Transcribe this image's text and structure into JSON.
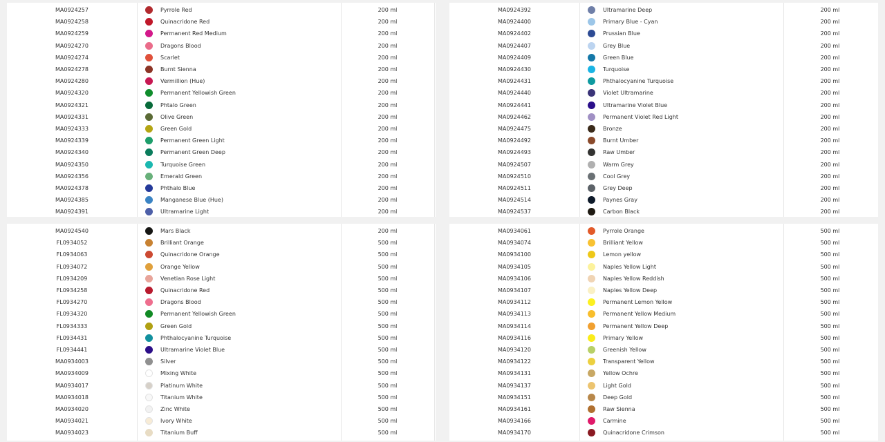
{
  "panels": [
    {
      "rows": [
        {
          "code": "MA0924257",
          "color": "#b22a2e",
          "name": "Pyrrole Red",
          "volume": "200 ml"
        },
        {
          "code": "MA0924258",
          "color": "#c0182a",
          "name": "Quinacridone Red",
          "volume": "200 ml"
        },
        {
          "code": "MA0924259",
          "color": "#d3198a",
          "name": "Permanent Red Medium",
          "volume": "200 ml"
        },
        {
          "code": "MA0924270",
          "color": "#ea6c8a",
          "name": "Dragons Blood",
          "volume": "200 ml"
        },
        {
          "code": "MA0924274",
          "color": "#e0513b",
          "name": "Scarlet",
          "volume": "200 ml"
        },
        {
          "code": "MA0924278",
          "color": "#8c3426",
          "name": "Burnt Sienna",
          "volume": "200 ml"
        },
        {
          "code": "MA0924280",
          "color": "#c71852",
          "name": "Vermillion (Hue)",
          "volume": "200 ml"
        },
        {
          "code": "MA0924320",
          "color": "#0f8c2c",
          "name": "Permanent Yellowish Green",
          "volume": "200 ml"
        },
        {
          "code": "MA0924321",
          "color": "#086a3a",
          "name": "Phtalo Green",
          "volume": "200 ml"
        },
        {
          "code": "MA0924331",
          "color": "#5b6a35",
          "name": "Olive Green",
          "volume": "200 ml"
        },
        {
          "code": "MA0924333",
          "color": "#b4a513",
          "name": "Green Gold",
          "volume": "200 ml"
        },
        {
          "code": "MA0924339",
          "color": "#1e9e6b",
          "name": "Permanent Green Light",
          "volume": "200 ml"
        },
        {
          "code": "MA0924340",
          "color": "#0a7c5c",
          "name": "Permanent Green Deep",
          "volume": "200 ml"
        },
        {
          "code": "MA0924350",
          "color": "#1bb8b0",
          "name": "Turquoise Green",
          "volume": "200 ml"
        },
        {
          "code": "MA0924356",
          "color": "#68b07a",
          "name": "Emerald Green",
          "volume": "200 ml"
        },
        {
          "code": "MA0924378",
          "color": "#253a9a",
          "name": "Phthalo Blue",
          "volume": "200 ml"
        },
        {
          "code": "MA0924385",
          "color": "#3b84c4",
          "name": "Manganese Blue (Hue)",
          "volume": "200 ml"
        },
        {
          "code": "MA0924391",
          "color": "#4d5fa8",
          "name": "Ultramarine Light",
          "volume": "200 ml"
        }
      ]
    },
    {
      "rows": [
        {
          "code": "MA0924392",
          "color": "#6f7fa8",
          "name": "Ultramarine Deep",
          "volume": "200 ml"
        },
        {
          "code": "MA0924400",
          "color": "#9cc6e8",
          "name": "Primary Blue - Cyan",
          "volume": "200 ml"
        },
        {
          "code": "MA0924402",
          "color": "#2d4b94",
          "name": "Prussian Blue",
          "volume": "200 ml"
        },
        {
          "code": "MA0924407",
          "color": "#bcd4f0",
          "name": "Grey Blue",
          "volume": "200 ml"
        },
        {
          "code": "MA0924409",
          "color": "#1478a8",
          "name": "Green Blue",
          "volume": "200 ml"
        },
        {
          "code": "MA0924430",
          "color": "#1ab4e4",
          "name": "Turquoise",
          "volume": "200 ml"
        },
        {
          "code": "MA0924431",
          "color": "#0e9aa0",
          "name": "Phthalocyanine Turquoise",
          "volume": "200 ml"
        },
        {
          "code": "MA0924440",
          "color": "#3a3478",
          "name": "Violet Ultramarine",
          "volume": "200 ml"
        },
        {
          "code": "MA0924441",
          "color": "#2a0e8a",
          "name": "Ultramarine Violet Blue",
          "volume": "200 ml"
        },
        {
          "code": "MA0924462",
          "color": "#a090c4",
          "name": "Permanent Violet Red Light",
          "volume": "200 ml"
        },
        {
          "code": "MA0924475",
          "color": "#3a2a1a",
          "name": "Bronze",
          "volume": "200 ml"
        },
        {
          "code": "MA0924492",
          "color": "#8a4a2c",
          "name": "Burnt Umber",
          "volume": "200 ml"
        },
        {
          "code": "MA0924493",
          "color": "#333331",
          "name": "Raw Umber",
          "volume": "200 ml"
        },
        {
          "code": "MA0924507",
          "color": "#b0b0b0",
          "name": "Warm Grey",
          "volume": "200 ml"
        },
        {
          "code": "MA0924510",
          "color": "#6a7074",
          "name": "Cool Grey",
          "volume": "200 ml"
        },
        {
          "code": "MA0924511",
          "color": "#5c6268",
          "name": "Grey Deep",
          "volume": "200 ml"
        },
        {
          "code": "MA0924514",
          "color": "#0e1a2a",
          "name": "Paynes Gray",
          "volume": "200 ml"
        },
        {
          "code": "MA0924537",
          "color": "#1e1a12",
          "name": "Carbon Black",
          "volume": "200 ml"
        }
      ]
    },
    {
      "rows": [
        {
          "code": "MA0924540",
          "color": "#161614",
          "name": "Mars Black",
          "volume": "200 ml"
        },
        {
          "code": "FL0934052",
          "color": "#c88232",
          "name": "Brilliant Orange",
          "volume": "500 ml"
        },
        {
          "code": "FL0934063",
          "color": "#cc4a32",
          "name": "Quinacridone Orange",
          "volume": "500 ml"
        },
        {
          "code": "FL0934072",
          "color": "#e0a03c",
          "name": "Orange Yellow",
          "volume": "500 ml"
        },
        {
          "code": "FL0934209",
          "color": "#e8a49a",
          "name": "Venetian Rose Light",
          "volume": "500 ml"
        },
        {
          "code": "FL0934258",
          "color": "#b81a2e",
          "name": "Quinacridone Red",
          "volume": "500 ml"
        },
        {
          "code": "FL0934270",
          "color": "#ee6e8e",
          "name": "Dragons Blood",
          "volume": "500 ml"
        },
        {
          "code": "FL0934320",
          "color": "#118a24",
          "name": "Permanent Yellowish Green",
          "volume": "500 ml"
        },
        {
          "code": "FL0934333",
          "color": "#b0a012",
          "name": "Green Gold",
          "volume": "500 ml"
        },
        {
          "code": "FL0934431",
          "color": "#12909e",
          "name": "Phthalocyanine Turquoise",
          "volume": "500 ml"
        },
        {
          "code": "FL0934441",
          "color": "#2c0e88",
          "name": "Ultramarine Violet Blue",
          "volume": "500 ml"
        },
        {
          "code": "MA0934003",
          "color": "#909090",
          "name": "Silver",
          "volume": "500 ml"
        },
        {
          "code": "MA0934009",
          "color": "#ffffff",
          "name": "Mixing White",
          "volume": "500 ml",
          "light": true
        },
        {
          "code": "MA0934017",
          "color": "#d6d0c8",
          "name": "Platinum White",
          "volume": "500 ml",
          "light": true
        },
        {
          "code": "MA0934018",
          "color": "#f8f8f8",
          "name": "Titanium White",
          "volume": "500 ml",
          "light": true
        },
        {
          "code": "MA0934020",
          "color": "#f2f2f2",
          "name": "Zinc White",
          "volume": "500 ml",
          "light": true
        },
        {
          "code": "MA0934021",
          "color": "#f8ecd6",
          "name": "Ivory White",
          "volume": "500 ml",
          "light": true
        },
        {
          "code": "MA0934023",
          "color": "#e8dcc4",
          "name": "Titanium Buff",
          "volume": "500 ml"
        }
      ]
    },
    {
      "rows": [
        {
          "code": "MA0934061",
          "color": "#e25a2a",
          "name": "Pyrrole Orange",
          "volume": "500 ml"
        },
        {
          "code": "MA0934074",
          "color": "#f8c232",
          "name": "Brilliant Yellow",
          "volume": "500 ml"
        },
        {
          "code": "MA0934100",
          "color": "#eec818",
          "name": "Lemon yellow",
          "volume": "500 ml"
        },
        {
          "code": "MA0934105",
          "color": "#fcf29c",
          "name": "Naples Yellow Light",
          "volume": "500 ml"
        },
        {
          "code": "MA0934106",
          "color": "#f0d4b4",
          "name": "Naples Yellow Reddish",
          "volume": "500 ml"
        },
        {
          "code": "MA0934107",
          "color": "#faf0c4",
          "name": "Naples Yellow Deep",
          "volume": "500 ml"
        },
        {
          "code": "MA0934112",
          "color": "#fcf020",
          "name": "Permanent Lemon Yellow",
          "volume": "500 ml"
        },
        {
          "code": "MA0934113",
          "color": "#f8be2c",
          "name": "Permanent Yellow Medium",
          "volume": "500 ml"
        },
        {
          "code": "MA0934114",
          "color": "#f0a030",
          "name": "Permanent Yellow Deep",
          "volume": "500 ml"
        },
        {
          "code": "MA0934116",
          "color": "#faec1a",
          "name": "Primary Yellow",
          "volume": "500 ml"
        },
        {
          "code": "MA0934120",
          "color": "#b8d068",
          "name": "Greenish Yellow",
          "volume": "500 ml"
        },
        {
          "code": "MA0934122",
          "color": "#ecd040",
          "name": "Transparent Yellow",
          "volume": "500 ml"
        },
        {
          "code": "MA0934131",
          "color": "#c8a864",
          "name": "Yellow Ochre",
          "volume": "500 ml"
        },
        {
          "code": "MA0934137",
          "color": "#ecc470",
          "name": "Light Gold",
          "volume": "500 ml"
        },
        {
          "code": "MA0934151",
          "color": "#b8884a",
          "name": "Deep Gold",
          "volume": "500 ml"
        },
        {
          "code": "MA0934161",
          "color": "#b07030",
          "name": "Raw Sienna",
          "volume": "500 ml"
        },
        {
          "code": "MA0934166",
          "color": "#e01a6a",
          "name": "Carmine",
          "volume": "500 ml"
        },
        {
          "code": "MA0934170",
          "color": "#8a1a22",
          "name": "Quinacridone Crimson",
          "volume": "500 ml"
        }
      ]
    }
  ]
}
